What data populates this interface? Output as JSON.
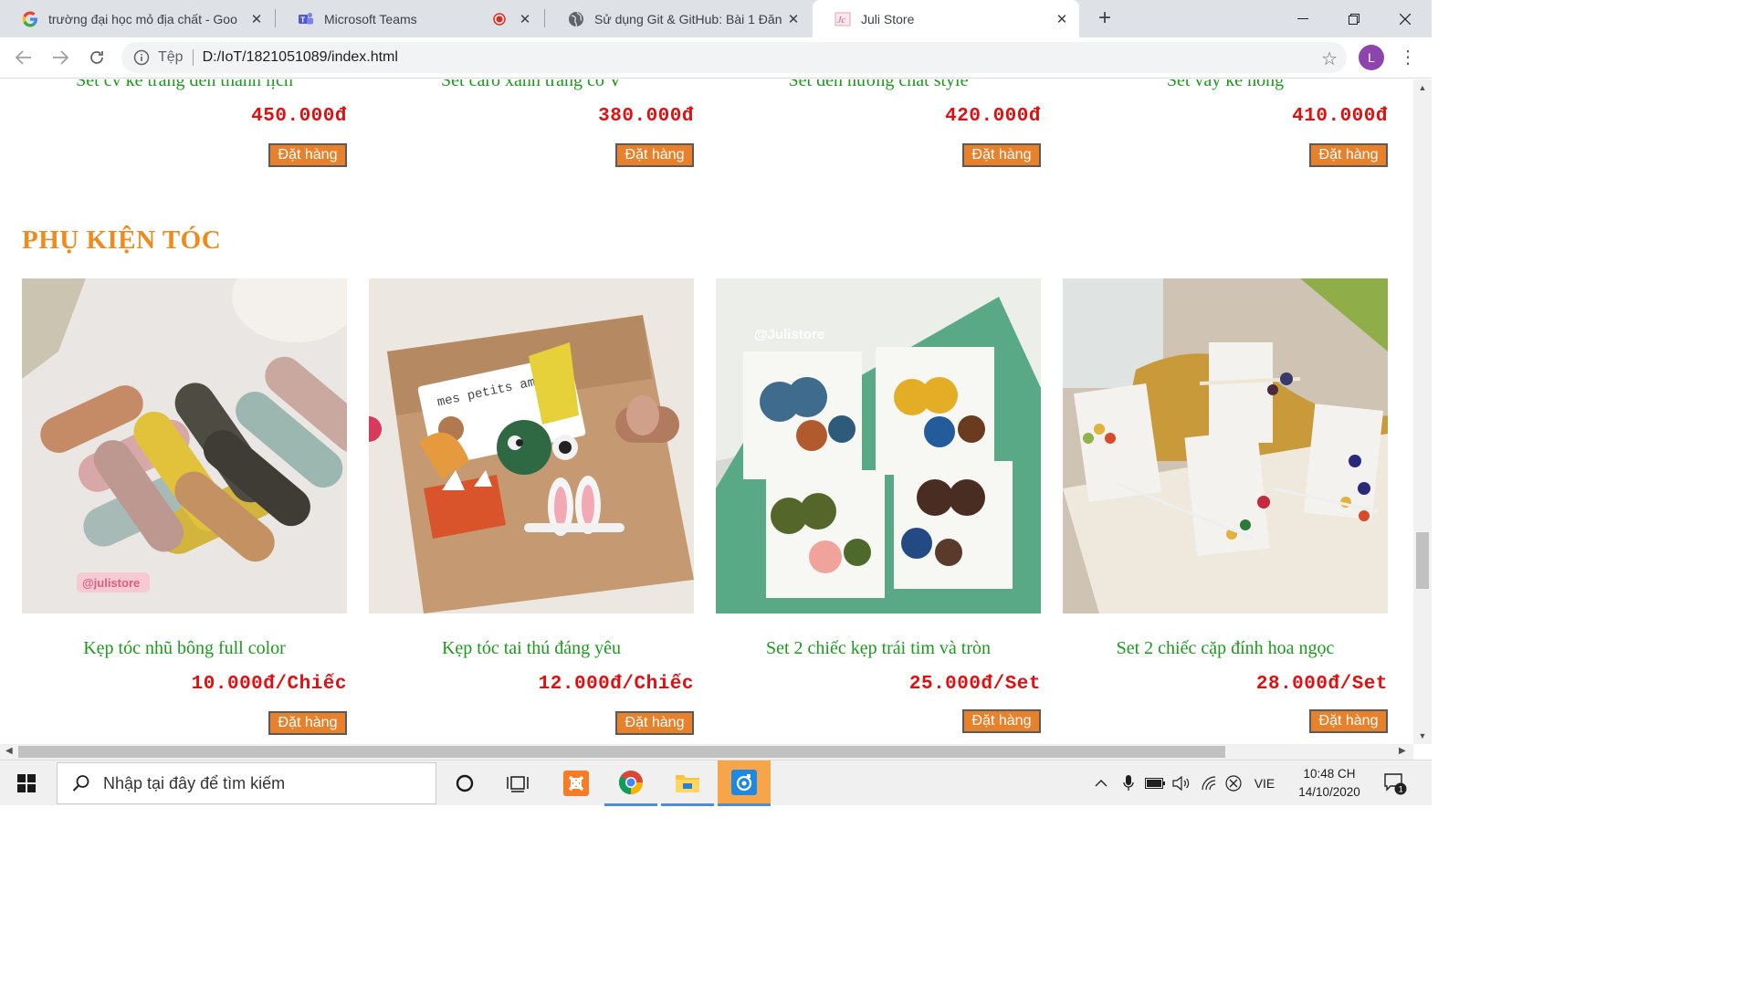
{
  "browser": {
    "tabs": [
      {
        "title": "trường đại học mỏ địa chất - Goo",
        "icon": "google-icon",
        "active": false
      },
      {
        "title": "Microsoft Teams",
        "icon": "teams-icon",
        "active": false
      },
      {
        "title": "Sử dụng Git & GitHub: Bài 1 Đăn",
        "icon": "globe-icon",
        "active": false
      },
      {
        "title": "Juli Store",
        "icon": "juli-store-icon",
        "active": true
      }
    ],
    "address": {
      "scheme": "Tệp",
      "url": "D:/IoT/1821051089/index.html"
    },
    "profile_initial": "L"
  },
  "page": {
    "top_row": [
      {
        "name": "Set cv kẻ trắng đen thanh lịch",
        "price": "450.000đ",
        "order_label": "Đặt hàng"
      },
      {
        "name": "Set caro xanh trắng cổ V",
        "price": "380.000đ",
        "order_label": "Đặt hàng"
      },
      {
        "name": "Set đen hướng chất style",
        "price": "420.000đ",
        "order_label": "Đặt hàng"
      },
      {
        "name": "Set váy kẻ hồng",
        "price": "410.000đ",
        "order_label": "Đặt hàng"
      }
    ],
    "section_title": "PHỤ KIỆN TÓC",
    "products": [
      {
        "name": "Kẹp tóc nhũ bông full color",
        "price": "10.000đ/Chiếc",
        "order_label": "Đặt hàng",
        "watermark": "@julistore"
      },
      {
        "name": "Kẹp tóc tai thú đáng yêu",
        "price": "12.000đ/Chiếc",
        "order_label": "Đặt hàng",
        "watermark": "mes petits amis"
      },
      {
        "name": "Set 2 chiếc kẹp trái tim và tròn",
        "price": "25.000đ/Set",
        "order_label": "Đặt hàng",
        "watermark": "@Julistore"
      },
      {
        "name": "Set 2 chiếc cặp đính hoa ngọc",
        "price": "28.000đ/Set",
        "order_label": "Đặt hàng",
        "watermark": ""
      }
    ]
  },
  "taskbar": {
    "search_placeholder": "Nhập tại đây để tìm kiếm",
    "language": "VIE",
    "time": "10:48 CH",
    "date": "14/10/2020",
    "notification_count": "1"
  },
  "colors": {
    "product_name": "#1c9a1c",
    "price": "#e01010",
    "section_title": "#f08a1c",
    "order_button": "#e8812b"
  }
}
